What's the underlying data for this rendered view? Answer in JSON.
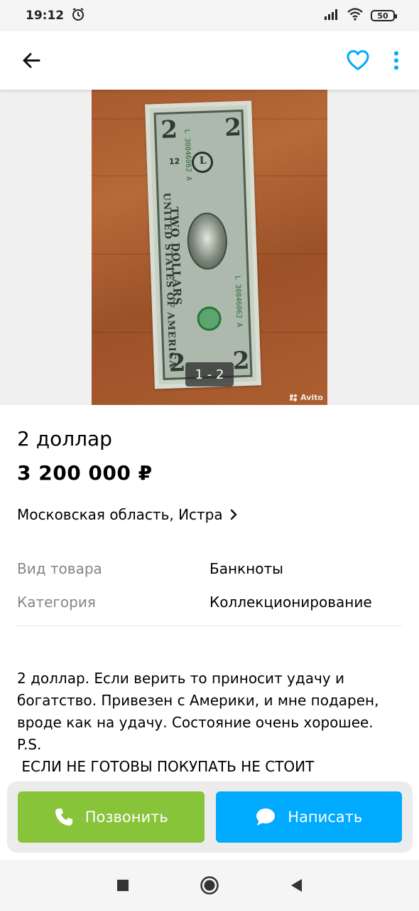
{
  "status_bar": {
    "time": "19:12",
    "battery": "50",
    "icons": [
      "alarm-icon",
      "signal-icon",
      "wifi-icon",
      "battery-icon"
    ]
  },
  "app_bar": {
    "icons": [
      "back-arrow-icon",
      "heart-outline-icon",
      "more-vert-icon"
    ],
    "accent": "#00aaff"
  },
  "gallery": {
    "counter": "1 - 2",
    "watermark": "Avito",
    "bill_text": "TWO DOLLARS",
    "bill_country": "UNITED STATES OF AMERICA",
    "bill_serial": "L 30846062 A",
    "bill_denomination": "2",
    "bill_district": "L",
    "bill_plate": "12"
  },
  "listing": {
    "title": "2 доллар",
    "price": "3 200 000 ₽",
    "location": "Московская область, Истра",
    "params": [
      {
        "key": "Вид товара",
        "value": "Банкноты"
      },
      {
        "key": "Категория",
        "value": "Коллекционирование"
      }
    ],
    "description_lines": [
      "2 доллар. Если верить то приносит удачу и",
      "богатство. Привезен с Америки, и мне подарен,",
      "вроде как на удачу. Состояние очень хорошее.",
      "P.S.",
      " ЕСЛИ НЕ ГОТОВЫ ПОКУПАТЬ НЕ СТОИТ"
    ]
  },
  "actions": {
    "call_label": "Позвонить",
    "write_label": "Написать",
    "call_color": "#87c43a",
    "write_color": "#00aaff"
  },
  "nav_bar": {
    "icons": [
      "recents-square-icon",
      "home-circle-icon",
      "back-triangle-icon"
    ]
  }
}
